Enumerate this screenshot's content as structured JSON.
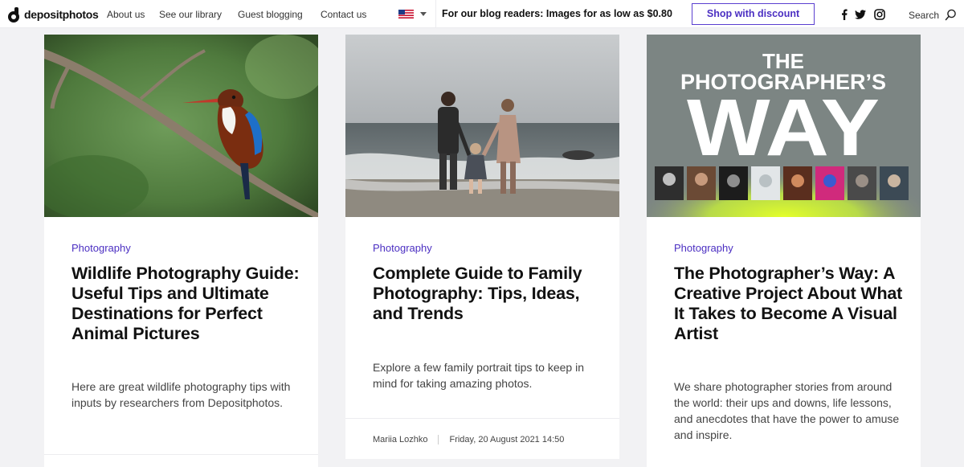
{
  "header": {
    "logo_text": "depositphotos",
    "nav": [
      {
        "label": "About us"
      },
      {
        "label": "See our library"
      },
      {
        "label": "Guest blogging"
      },
      {
        "label": "Contact us"
      }
    ],
    "language_flag": "us-flag-icon",
    "promo_text": "For our blog readers: Images for as low as $0.80",
    "shop_button": "Shop with discount",
    "social_icons": [
      "facebook-icon",
      "twitter-icon",
      "instagram-icon"
    ],
    "search_label": "Search",
    "accent_color": "#4b2fc2"
  },
  "cards": [
    {
      "category": "Photography",
      "title": "Wildlife Photography Guide: Useful Tips and Ultimate Destinations for Perfect Animal Pictures",
      "excerpt": "Here are great wildlife photography tips with inputs by researchers from Depositphotos."
    },
    {
      "category": "Photography",
      "title": "Complete Guide to Family Photography: Tips, Ideas, and Trends",
      "excerpt": "Explore a few family portrait tips to keep in mind for taking amazing photos.",
      "author": "Mariia Lozhko",
      "date": "Friday, 20 August 2021 14:50"
    },
    {
      "category": "Photography",
      "image_text_line1": "THE",
      "image_text_line2": "PHOTOGRAPHER’S",
      "image_text_line3": "WAY",
      "title": "The Photographer’s Way: A Creative Project About What It Takes to Become A Visual Artist",
      "excerpt": "We share photographer stories from around the world: their ups and downs, life lessons, and anecdotes that have the power to amuse and inspire."
    }
  ]
}
